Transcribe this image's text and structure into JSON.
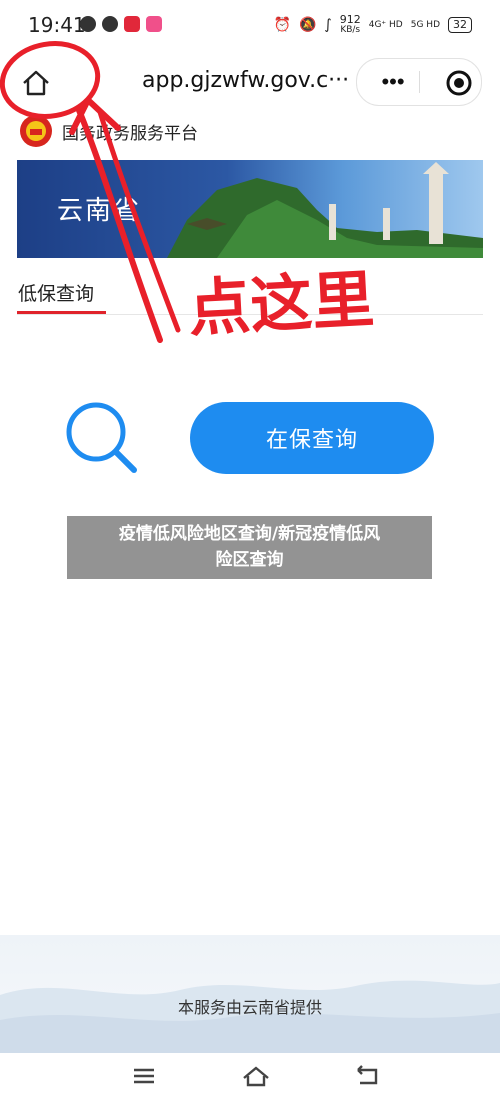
{
  "status_bar": {
    "time": "19:41",
    "net_speed_value": "912",
    "net_speed_unit": "KB/s",
    "signal_1": "4G⁺ HD",
    "signal_2": "5G HD",
    "battery": "32"
  },
  "browser": {
    "url": "app.gjzwfw.gov.c···",
    "more_label": "•••"
  },
  "platform": {
    "name": "国务政务服务平台"
  },
  "banner": {
    "title": "云南省"
  },
  "tabs": [
    {
      "label": "低保查询",
      "active": true
    }
  ],
  "annotation": {
    "handwritten_note": "点这里"
  },
  "search": {
    "button_label": "在保查询"
  },
  "overlay": {
    "line1": "疫情低风险地区查询/新冠疫情低风",
    "line2": "险区查询"
  },
  "footer": {
    "text": "本服务由云南省提供"
  },
  "colors": {
    "primary_button": "#1e8cf0",
    "tab_underline": "#e0232b",
    "annotation_red": "#e8202a",
    "banner_dark": "#1d3f86"
  }
}
